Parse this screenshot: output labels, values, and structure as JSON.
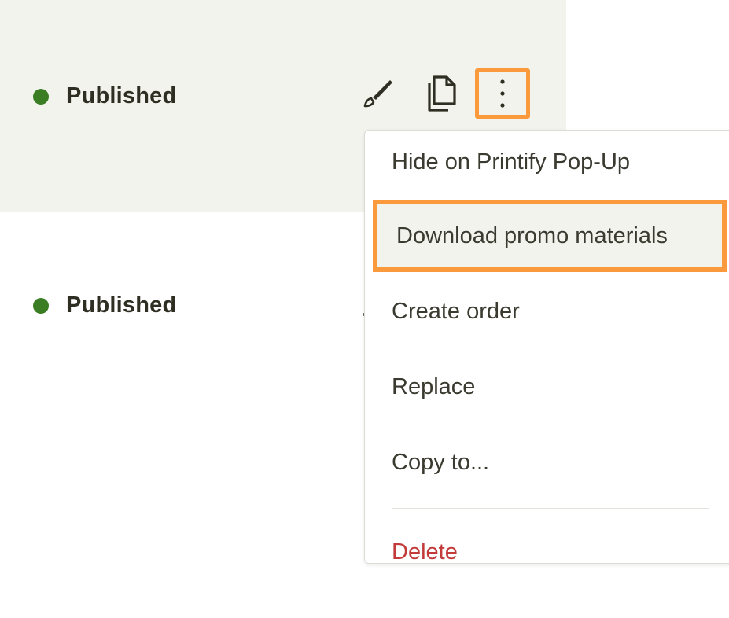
{
  "rows": [
    {
      "status": "Published",
      "status_color": "#3b7d23"
    },
    {
      "status": "Published",
      "status_color": "#3b7d23"
    }
  ],
  "actions": {
    "edit_icon": "pencil-icon",
    "copy_icon": "duplicate-icon",
    "more_icon": "vertical-ellipsis-icon"
  },
  "menu": {
    "items": [
      {
        "label": "Hide on Printify Pop-Up"
      },
      {
        "label": "Download promo materials"
      },
      {
        "label": "Create order"
      },
      {
        "label": "Replace"
      },
      {
        "label": "Copy to..."
      }
    ],
    "delete_label": "Delete",
    "delete_color": "#c23a3a"
  },
  "highlight_color": "#fb9a3c"
}
